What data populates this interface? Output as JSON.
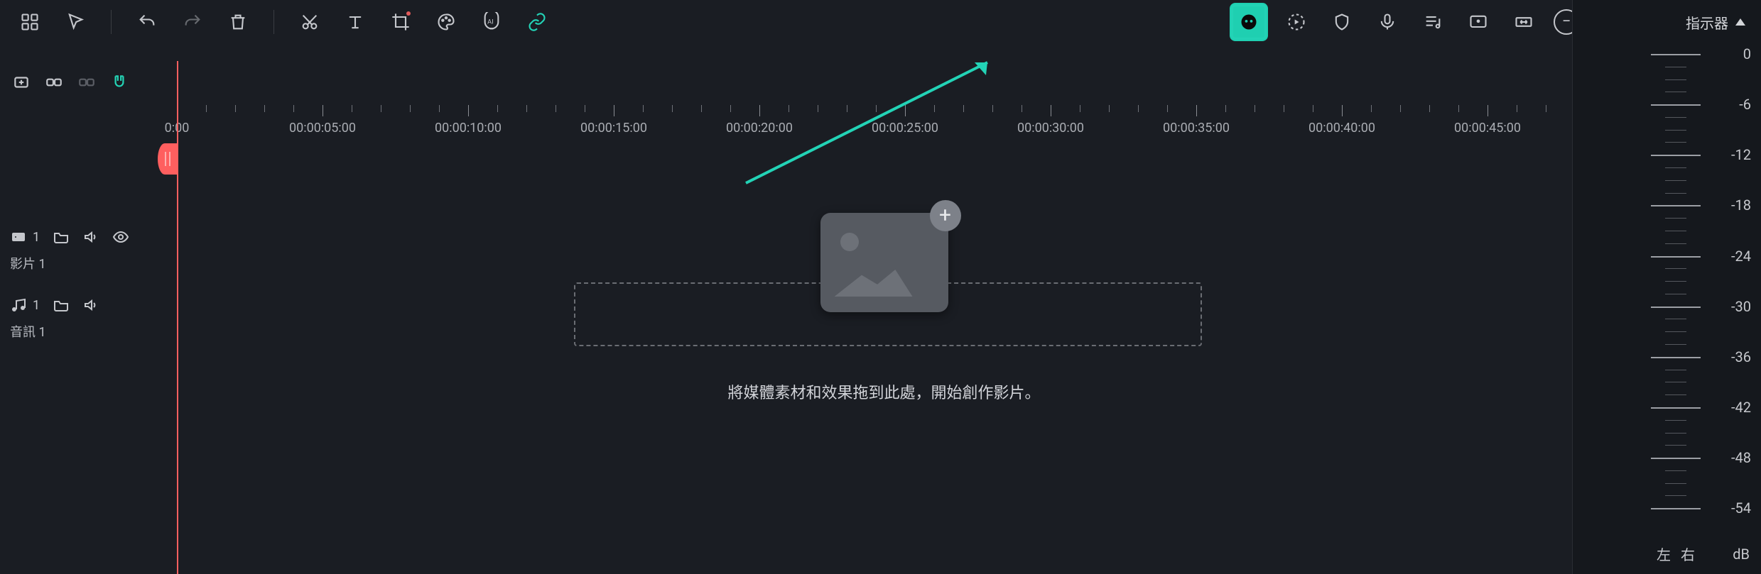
{
  "toolbar": {
    "zoom_minus": "−",
    "zoom_plus": "+"
  },
  "ruler": {
    "labels": [
      "0:00",
      "00:00:05:00",
      "00:00:10:00",
      "00:00:15:00",
      "00:00:20:00",
      "00:00:25:00",
      "00:00:30:00",
      "00:00:35:00",
      "00:00:40:00",
      "00:00:45:00"
    ]
  },
  "tracks": {
    "video": {
      "count": "1",
      "label": "影片 1"
    },
    "audio": {
      "count": "1",
      "label": "音訊 1"
    }
  },
  "drop": {
    "hint": "將媒體素材和效果拖到此處，開始創作影片。",
    "plus": "+"
  },
  "meter": {
    "title": "指示器",
    "values": [
      "0",
      "-6",
      "-12",
      "-18",
      "-24",
      "-30",
      "-36",
      "-42",
      "-48",
      "-54"
    ],
    "left": "左",
    "right": "右",
    "unit": "dB"
  }
}
